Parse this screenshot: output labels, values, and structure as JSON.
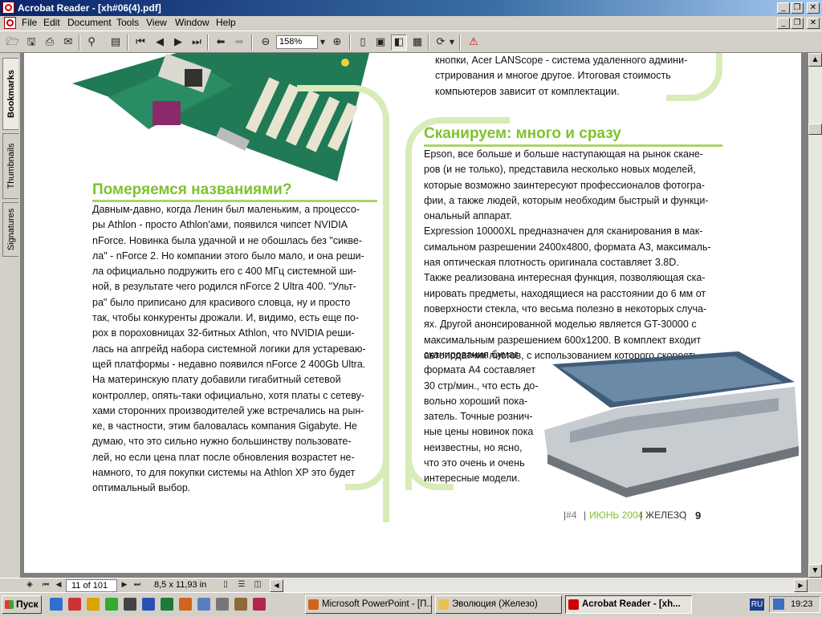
{
  "window": {
    "title": "Acrobat Reader - [xh#06(4).pdf]",
    "controls": [
      "_",
      "❐",
      "✕"
    ]
  },
  "menu": [
    "File",
    "Edit",
    "Document",
    "Tools",
    "View",
    "Window",
    "Help"
  ],
  "toolbar": {
    "zoom": "158%"
  },
  "nav_tabs": [
    "Bookmarks",
    "Thumbnails",
    "Signatures"
  ],
  "document": {
    "left_heading": "Померяемся названиями?",
    "left_text": "Давным-давно, когда Ленин был маленьким, а процессо-\nры Athlon - просто Athlon'ами, появился чипсет NVIDIA\nnForce. Новинка была удачной и не обошлась без \"сикве-\nла\" - nForce 2. Но компании этого было мало, и она реши-\nла официально подружить его с 400 МГц системной ши-\nной, в результате чего родился nForce 2 Ultra 400. \"Ульт-\nра\" было приписано для красивого словца, ну и просто\nтак, чтобы конкуренты дрожали. И, видимо, есть еще по-\nрох в пороховницах 32-битных Athlon, что NVIDIA реши-\nлась на апгрейд набора системной логики для устареваю-\nщей платформы - недавно появился nForce 2 400Gb Ultra.\nНа материнскую плату добавили гигабитный сетевой\nконтроллер, опять-таки официально, хотя платы с сетеву-\nхами сторонних производителей уже встречались на рын-\nке, в частности, этим баловалась компания Gigabyte. Не\nдумаю, что это сильно нужно большинству пользовате-\nлей, но если цена плат после обновления возрастет не-\nнамного, то для покупки системы на Athlon XP это будет\nоптимальный выбор.",
    "right_top_text": "кнопки, Acer LANScope - система удаленного админи-\nстрирования и многое другое. Итоговая стоимость\nкомпьютеров зависит от комплектации.",
    "right_heading": "Сканируем: много и сразу",
    "right_text": "Epson, все больше и больше наступающая на рынок скане-\nров (и не только), представила несколько новых моделей,\nкоторые возможно заинтересуют профессионалов фотогра-\nфии, а также людей, которым необходим быстрый и функци-\nональный аппарат.\nExpression 10000XL предназначен для сканирования в мак-\nсимальном разрешении 2400x4800, формата А3, максималь-\nная оптическая плотность оригинала составляет 3.8D.\nТакже реализована интересная функция, позволяющая ска-\nнировать предметы, находящиеся на расстоянии до 6 мм от\nповерхности стекла, что весьма полезно в некоторых случа-\nях. Другой анонсированной моделью является GT-30000 с\nмаксимальным разрешением 600x1200. В комплект входит\nавтоподатчик листов, с использованием которого скорость",
    "right_wrap_text": "сканирования бумаг\nформата А4 составляет\n30 стр/мин., что есть до-\nвольно хороший пока-\nзатель. Точные рознич-\nные цены новинок пока\nнеизвестны, но ясно,\nчто это очень и очень\nинтересные модели.",
    "footer": {
      "issue": "#4",
      "date": "ИЮНЬ 2004",
      "magazine": "ЖЕЛЕЗО",
      "page": "9"
    }
  },
  "statusbar": {
    "page_field": "11 of 101",
    "page_size": "8,5 x 11,93 in"
  },
  "taskbar": {
    "start": "Пуск",
    "tasks": [
      {
        "label": "Microsoft PowerPoint - [П...",
        "active": false
      },
      {
        "label": "Эволюция (Железо)",
        "active": false
      },
      {
        "label": "Acrobat Reader - [xh...",
        "active": true
      }
    ],
    "lang": "RU",
    "clock": "19:23"
  },
  "colors": {
    "accent_green": "#7fc22e",
    "title_bar": "#0a246a"
  }
}
